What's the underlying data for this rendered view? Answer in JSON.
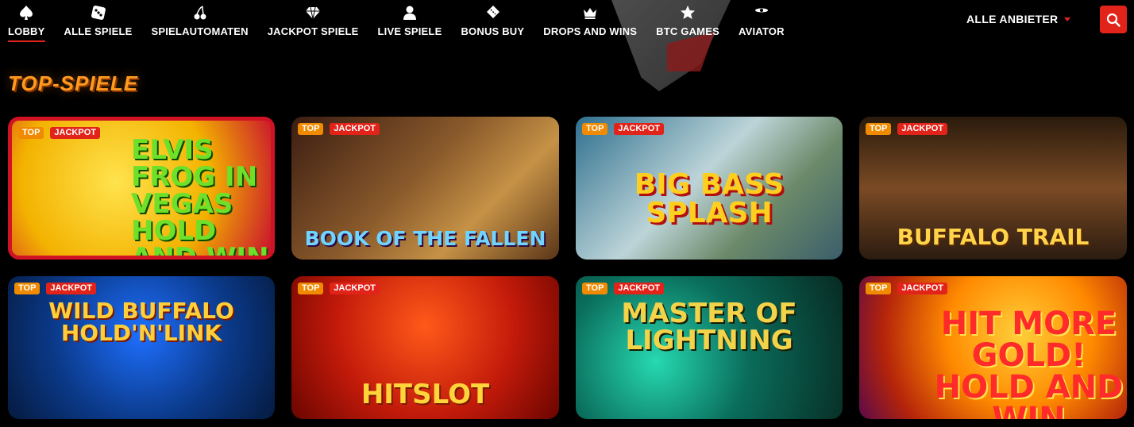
{
  "nav": {
    "items": [
      {
        "label": "LOBBY",
        "icon": "spade-icon",
        "active": true
      },
      {
        "label": "ALLE SPIELE",
        "icon": "dice-icon"
      },
      {
        "label": "SPIELAUTOMATEN",
        "icon": "cherries-icon"
      },
      {
        "label": "JACKPOT SPIELE",
        "icon": "diamond-icon"
      },
      {
        "label": "LIVE SPIELE",
        "icon": "person-icon"
      },
      {
        "label": "BONUS BUY",
        "icon": "ticket-icon"
      },
      {
        "label": "DROPS AND WINS",
        "icon": "crown-icon"
      },
      {
        "label": "BTC GAMES",
        "icon": "star-icon"
      },
      {
        "label": "AVIATOR",
        "icon": "plane-icon"
      }
    ]
  },
  "header": {
    "provider_label": "ALLE ANBIETER",
    "accent_color": "#e2231a"
  },
  "section": {
    "title": "TOP-SPIELE"
  },
  "games": [
    {
      "title": "ELVIS FROG IN VEGAS HOLD AND WIN",
      "badges": [
        "TOP",
        "JACKPOT"
      ]
    },
    {
      "title": "BOOK OF THE FALLEN",
      "badges": [
        "TOP",
        "JACKPOT"
      ]
    },
    {
      "title": "BIG BASS SPLASH",
      "badges": [
        "TOP",
        "JACKPOT"
      ]
    },
    {
      "title": "BUFFALO TRAIL",
      "badges": [
        "TOP",
        "JACKPOT"
      ]
    },
    {
      "title": "WILD BUFFALO HOLD'N'LINK",
      "badges": [
        "TOP",
        "JACKPOT"
      ]
    },
    {
      "title": "HITSLOT",
      "badges": [
        "TOP",
        "JACKPOT"
      ]
    },
    {
      "title": "MASTER OF LIGHTNING",
      "badges": [
        "TOP",
        "JACKPOT"
      ]
    },
    {
      "title": "HIT MORE GOLD! HOLD AND WIN",
      "badges": [
        "TOP",
        "JACKPOT"
      ]
    }
  ]
}
